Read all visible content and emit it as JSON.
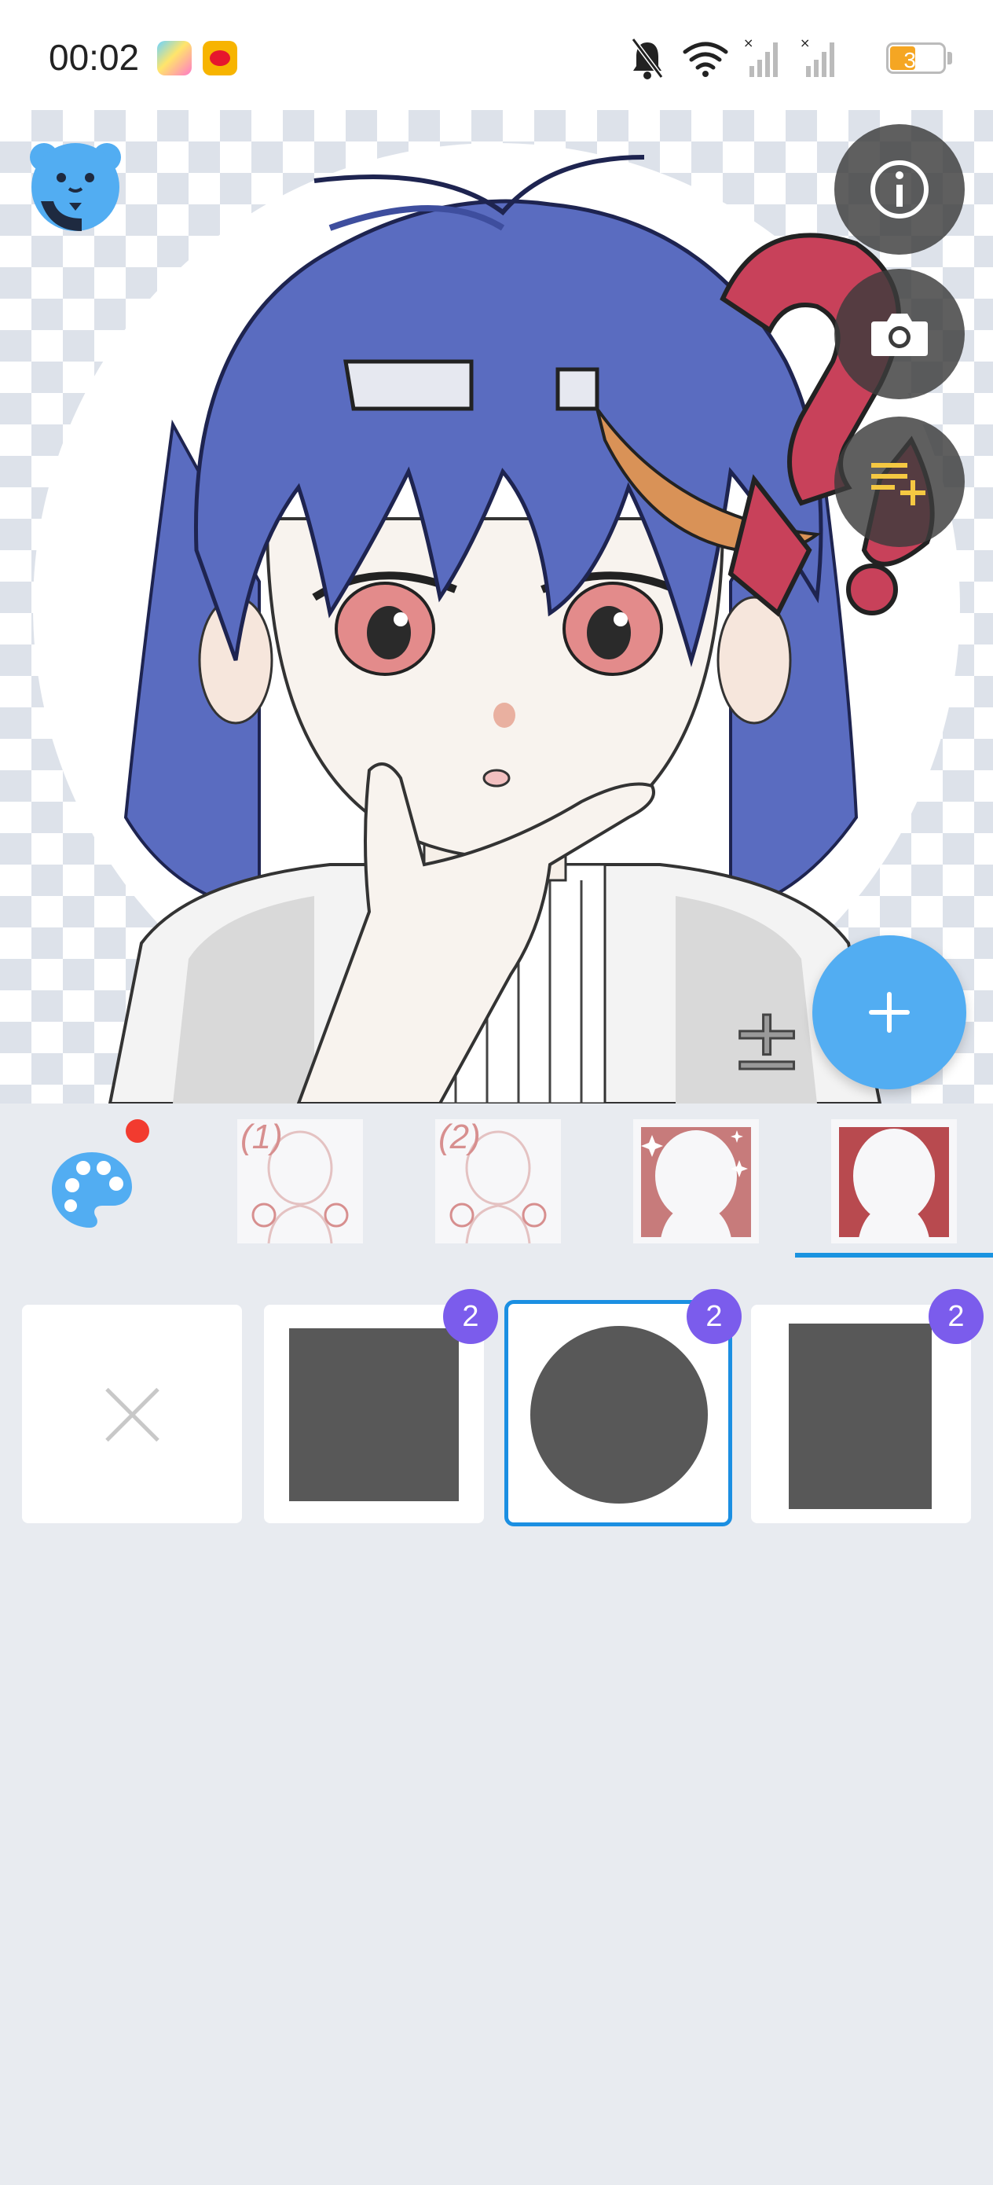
{
  "status_bar": {
    "time": "00:02",
    "battery": "32",
    "icons": [
      "app-icon",
      "weibo-icon",
      "mute-icon",
      "wifi-icon",
      "signal-icon",
      "signal-icon",
      "battery-icon"
    ]
  },
  "canvas": {
    "fab_icons": [
      "info-icon",
      "camera-icon",
      "playlist-add-icon",
      "add-icon"
    ]
  },
  "categories": {
    "items": [
      {
        "label": "(1)",
        "icon": "body-outline-1"
      },
      {
        "label": "(2)",
        "icon": "body-outline-2"
      },
      {
        "label": "",
        "icon": "sparkle-frame"
      },
      {
        "label": "",
        "icon": "solid-frame",
        "selected": true
      }
    ]
  },
  "options": {
    "items": [
      {
        "kind": "none"
      },
      {
        "kind": "square",
        "badge": "2"
      },
      {
        "kind": "circle",
        "badge": "2",
        "selected": true
      },
      {
        "kind": "rectangle",
        "badge": "2"
      }
    ]
  },
  "colors": {
    "accent": "#1b8fe2",
    "fab": "#52adf2",
    "badge": "#7b5cec",
    "hair": "#5a6cc0",
    "shape": "#585858"
  }
}
